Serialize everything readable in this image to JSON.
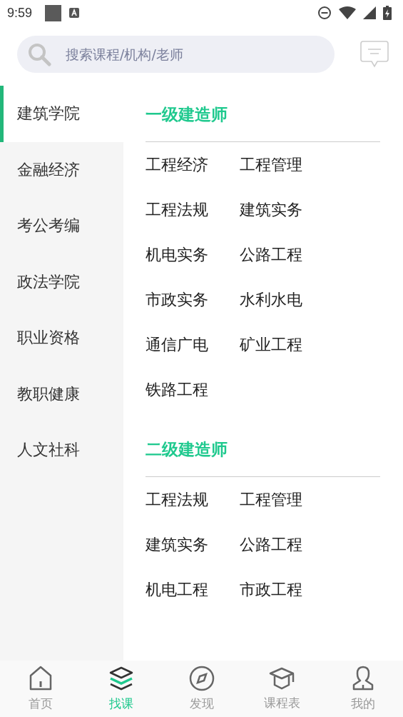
{
  "status_bar": {
    "time": "9:59"
  },
  "search": {
    "placeholder": "搜索课程/机构/老师"
  },
  "sidebar": {
    "items": [
      {
        "label": "建筑学院",
        "selected": true
      },
      {
        "label": "金融经济",
        "selected": false
      },
      {
        "label": "考公考编",
        "selected": false
      },
      {
        "label": "政法学院",
        "selected": false
      },
      {
        "label": "职业资格",
        "selected": false
      },
      {
        "label": "教职健康",
        "selected": false
      },
      {
        "label": "人文社科",
        "selected": false
      }
    ]
  },
  "sections": [
    {
      "title": "一级建造师",
      "items": [
        "工程经济",
        "工程管理",
        "工程法规",
        "建筑实务",
        "机电实务",
        "公路工程",
        "市政实务",
        "水利水电",
        "通信广电",
        "矿业工程",
        "铁路工程"
      ]
    },
    {
      "title": "二级建造师",
      "items": [
        "工程法规",
        "工程管理",
        "建筑实务",
        "公路工程",
        "机电工程",
        "市政工程"
      ]
    }
  ],
  "bottom_nav": [
    {
      "kind": "home",
      "label": "首页",
      "selected": false
    },
    {
      "kind": "layers",
      "label": "找课",
      "selected": true
    },
    {
      "kind": "compass",
      "label": "发现",
      "selected": false
    },
    {
      "kind": "cap",
      "label": "课程表",
      "selected": false
    },
    {
      "kind": "person",
      "label": "我的",
      "selected": false
    }
  ]
}
